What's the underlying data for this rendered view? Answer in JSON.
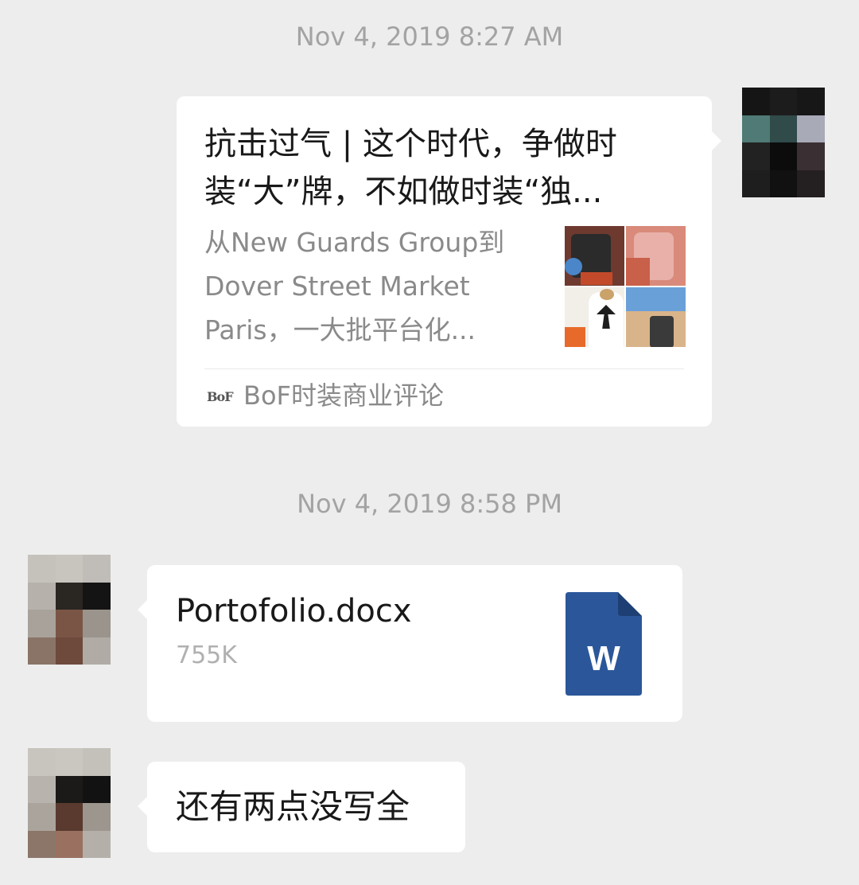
{
  "messages": [
    {
      "timestamp": "Nov 4, 2019 8:27 AM",
      "type": "article",
      "title": "抗击过气 | 这个时代，争做时装“大”牌，不如做时装“独...",
      "summary": "从New Guards Group到Dover Street Market Paris，一大批平台化...",
      "source_logo": "BoF",
      "source": "BoF时装商业评论"
    },
    {
      "timestamp": "Nov 4, 2019 8:58 PM",
      "type": "file",
      "file_name": "Portofolio.docx",
      "file_size": "755K",
      "file_icon": "word-document-icon",
      "file_icon_letter": "W",
      "file_icon_color": "#2b579a"
    },
    {
      "type": "text",
      "text": "还有两点没写全"
    }
  ]
}
